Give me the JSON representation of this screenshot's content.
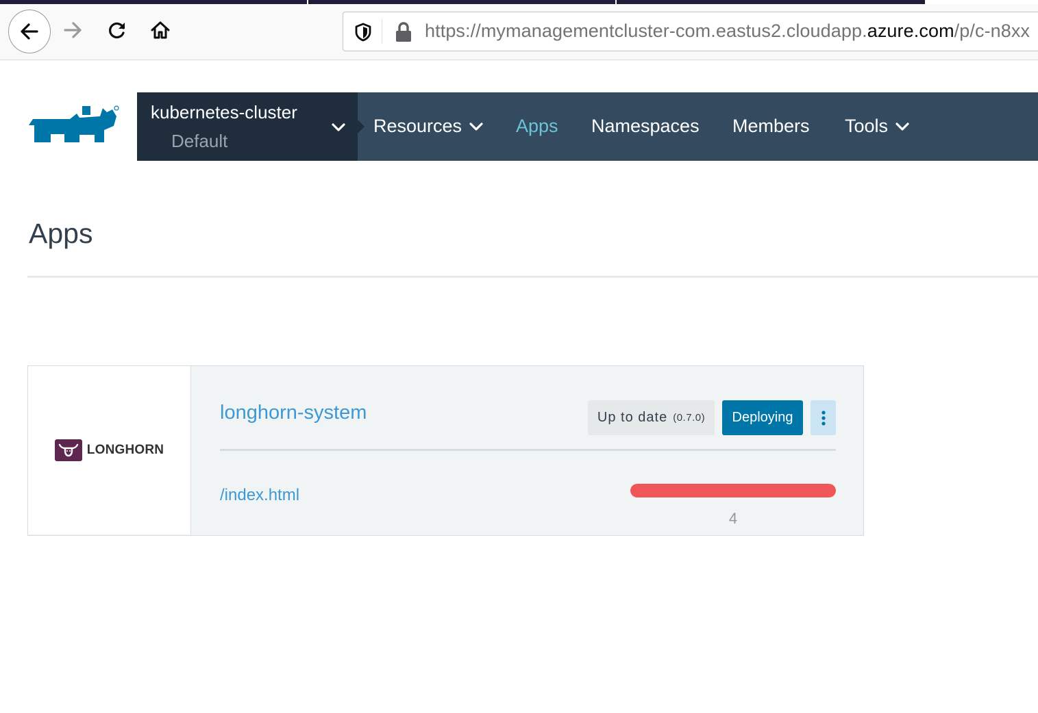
{
  "browser": {
    "url": {
      "prefix": "https://mymanagementcluster-com.eastus2.cloudapp.",
      "domain": "azure.com",
      "suffix": "/p/c-n8xx"
    }
  },
  "header": {
    "cluster_name": "kubernetes-cluster",
    "project_name": "Default",
    "nav": {
      "resources": "Resources",
      "apps": "Apps",
      "namespaces": "Namespaces",
      "members": "Members",
      "tools": "Tools"
    },
    "active_nav": "Apps",
    "colors": {
      "nav_bg": "#334a5f",
      "cluster_bg": "#1f2d3d",
      "active": "#6cc3da"
    }
  },
  "page": {
    "title": "Apps"
  },
  "app": {
    "logo_text": "LONGHORN",
    "name": "longhorn-system",
    "status_label": "Up to date",
    "version": "(0.7.0)",
    "state_button": "Deploying",
    "endpoint": "/index.html",
    "progress_fraction": 1.0,
    "progress_count": "4",
    "colors": {
      "link": "#3d98d3",
      "deploying": "#0075a8",
      "progress": "#f05558",
      "logo": "#5e2750"
    }
  }
}
